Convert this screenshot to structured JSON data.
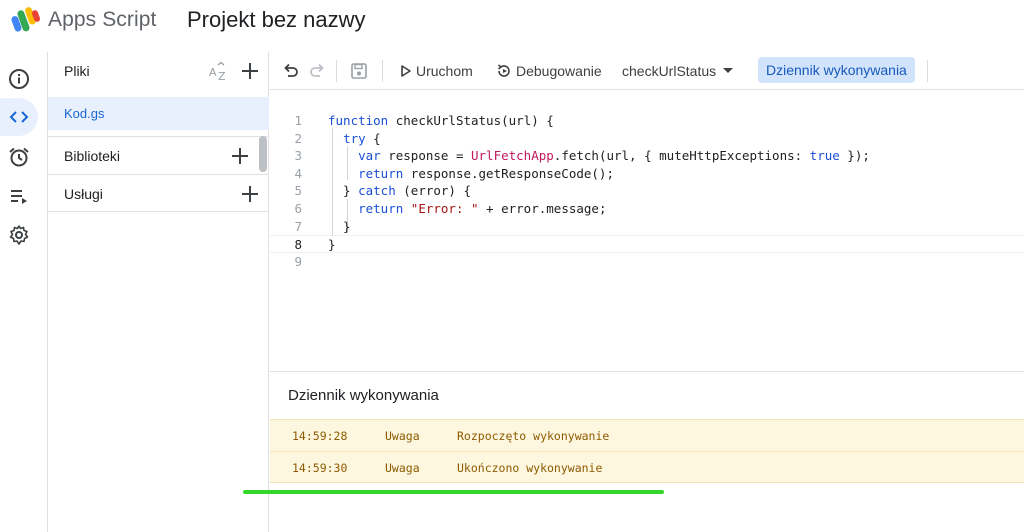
{
  "header": {
    "app_name": "Apps Script",
    "project_title": "Projekt bez nazwy"
  },
  "rail": {
    "items": [
      {
        "name": "overview",
        "icon": "info-icon"
      },
      {
        "name": "editor",
        "icon": "code-icon",
        "active": true
      },
      {
        "name": "triggers",
        "icon": "alarm-clock-icon"
      },
      {
        "name": "executions",
        "icon": "executions-list-icon"
      },
      {
        "name": "settings",
        "icon": "gear-icon"
      }
    ]
  },
  "files_panel": {
    "files_label": "Pliki",
    "active_file": "Kod.gs",
    "libraries_label": "Biblioteki",
    "services_label": "Usługi"
  },
  "toolbar": {
    "run_label": "Uruchom",
    "debug_label": "Debugowanie",
    "function_name": "checkUrlStatus",
    "execution_log_label": "Dziennik wykonywania"
  },
  "editor": {
    "current_line": 8,
    "lines": [
      "function checkUrlStatus(url) {",
      "  try {",
      "    var response = UrlFetchApp.fetch(url, { muteHttpExceptions: true });",
      "    return response.getResponseCode();",
      "  } catch (error) {",
      "    return \"Error: \" + error.message;",
      "  }",
      "}",
      ""
    ]
  },
  "execution_log": {
    "title": "Dziennik wykonywania",
    "entries": [
      {
        "time": "14:59:28",
        "level": "Uwaga",
        "message": "Rozpoczęto wykonywanie"
      },
      {
        "time": "14:59:30",
        "level": "Uwaga",
        "message": "Ukończono wykonywanie"
      }
    ]
  },
  "colors": {
    "accent": "#1967d2",
    "active_bg": "#e8f0fe",
    "log_bg": "#fef7e0",
    "highlight_line": "#35d62a"
  }
}
